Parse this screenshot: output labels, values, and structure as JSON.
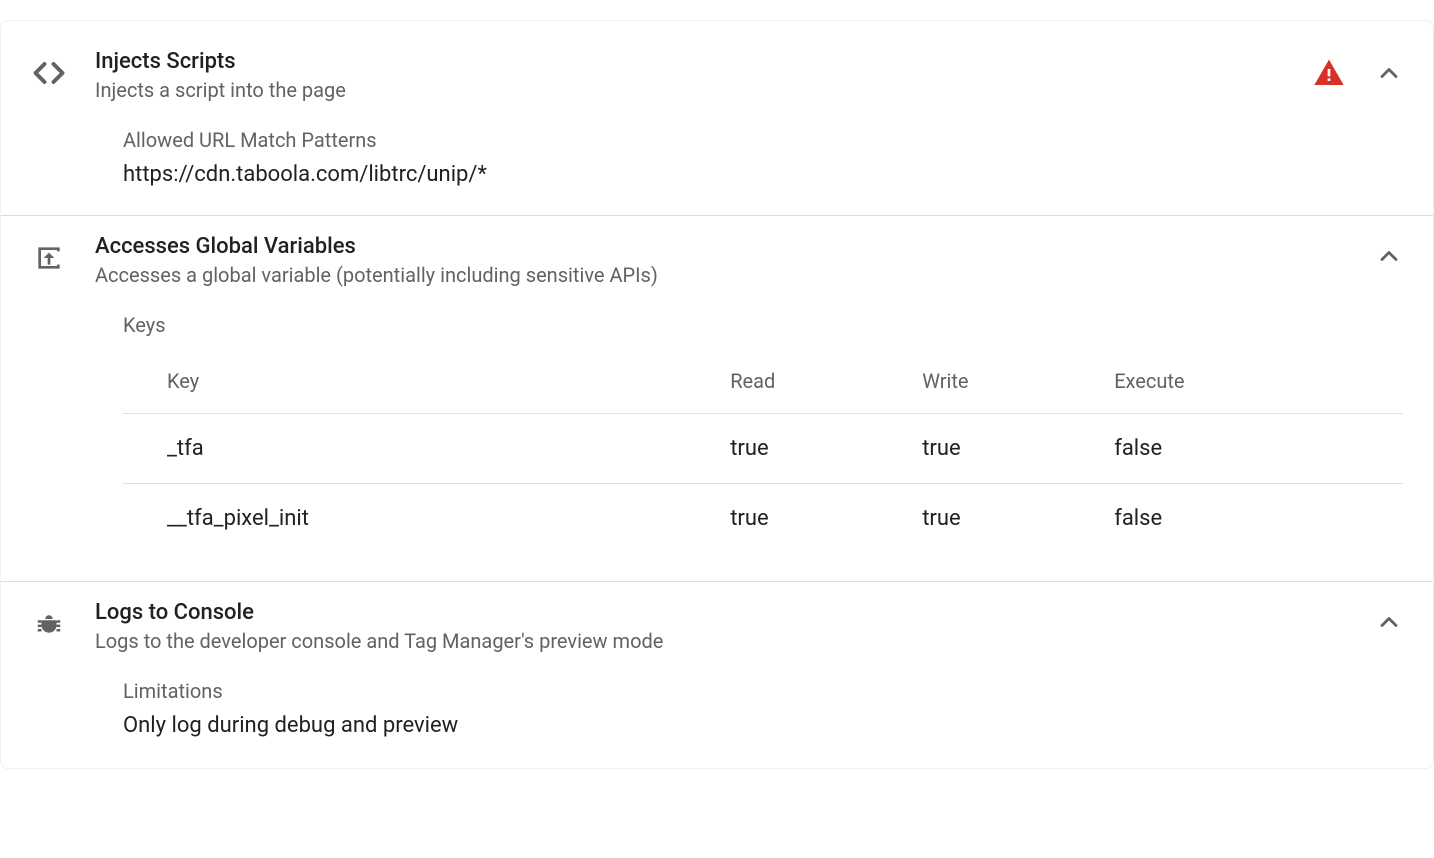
{
  "sections": {
    "injects": {
      "title": "Injects Scripts",
      "subtitle": "Injects a script into the page",
      "field_label": "Allowed URL Match Patterns",
      "field_value": "https://cdn.taboola.com/libtrc/unip/*"
    },
    "globals": {
      "title": "Accesses Global Variables",
      "subtitle": "Accesses a global variable (potentially including sensitive APIs)",
      "field_label": "Keys",
      "table": {
        "headers": {
          "key": "Key",
          "read": "Read",
          "write": "Write",
          "execute": "Execute"
        },
        "rows": [
          {
            "key": "_tfa",
            "read": "true",
            "write": "true",
            "execute": "false"
          },
          {
            "key": "__tfa_pixel_init",
            "read": "true",
            "write": "true",
            "execute": "false"
          }
        ]
      }
    },
    "logs": {
      "title": "Logs to Console",
      "subtitle": "Logs to the developer console and Tag Manager's preview mode",
      "field_label": "Limitations",
      "field_value": "Only log during debug and preview"
    }
  }
}
